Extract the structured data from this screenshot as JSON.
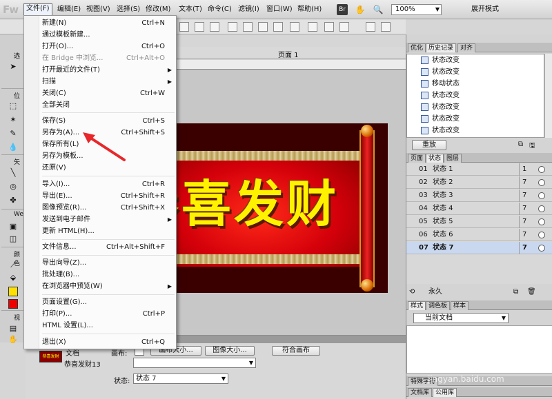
{
  "app": {
    "logo": "Fw",
    "zoom": "100%",
    "workspace_mode": "展开模式"
  },
  "menubar": {
    "items": [
      "文件(F)",
      "编辑(E)",
      "视图(V)",
      "选择(S)",
      "修改(M)",
      "文本(T)",
      "命令(C)",
      "滤镜(I)",
      "窗口(W)",
      "帮助(H)"
    ],
    "bridge_icon": "Br"
  },
  "document": {
    "page_label": "页面 1",
    "banner_text": "恭喜发财"
  },
  "tools_panel": {
    "labels": [
      "选",
      "位",
      "矢",
      "Web",
      "颜色",
      "视"
    ]
  },
  "file_menu": {
    "items": [
      {
        "label": "新建(N)",
        "shortcut": "Ctrl+N"
      },
      {
        "label": "通过模板新建...",
        "shortcut": ""
      },
      {
        "label": "打开(O)...",
        "shortcut": "Ctrl+O"
      },
      {
        "label": "在 Bridge 中浏览...",
        "shortcut": "Ctrl+Alt+O"
      },
      {
        "label": "打开最近的文件(T)",
        "shortcut": ""
      },
      {
        "label": "扫描",
        "shortcut": ""
      },
      {
        "label": "关闭(C)",
        "shortcut": "Ctrl+W"
      },
      {
        "label": "全部关闭",
        "shortcut": ""
      },
      {
        "label": "保存(S)",
        "shortcut": "Ctrl+S"
      },
      {
        "label": "另存为(A)...",
        "shortcut": "Ctrl+Shift+S"
      },
      {
        "label": "保存所有(L)",
        "shortcut": ""
      },
      {
        "label": "另存为模板...",
        "shortcut": ""
      },
      {
        "label": "还原(V)",
        "shortcut": ""
      },
      {
        "label": "导入(I)...",
        "shortcut": "Ctrl+R"
      },
      {
        "label": "导出(E)...",
        "shortcut": "Ctrl+Shift+R"
      },
      {
        "label": "图像预览(R)...",
        "shortcut": "Ctrl+Shift+X"
      },
      {
        "label": "发送到电子邮件",
        "shortcut": ""
      },
      {
        "label": "更新 HTML(H)...",
        "shortcut": ""
      },
      {
        "label": "文件信息...",
        "shortcut": "Ctrl+Alt+Shift+F"
      },
      {
        "label": "导出向导(Z)...",
        "shortcut": ""
      },
      {
        "label": "批处理(B)...",
        "shortcut": ""
      },
      {
        "label": "在浏览器中预览(W)",
        "shortcut": ""
      },
      {
        "label": "页面设置(G)...",
        "shortcut": ""
      },
      {
        "label": "打印(P)...",
        "shortcut": "Ctrl+P"
      },
      {
        "label": "HTML 设置(L)...",
        "shortcut": ""
      },
      {
        "label": "退出(X)",
        "shortcut": "Ctrl+Q"
      }
    ]
  },
  "properties": {
    "type_label": "文档",
    "doc_name": "恭喜发财13",
    "thumb_text": "恭喜发财",
    "canvas_label": "画布:",
    "canvas_size_button": "画布大小...",
    "image_size_button": "图像大小...",
    "fit_canvas_button": "符合画布",
    "state_label": "状态:",
    "state_value": "状态 7"
  },
  "right_panels": {
    "top_tabs": [
      "优化",
      "历史记录",
      "对齐"
    ],
    "history_items": [
      "状态改变",
      "状态改变",
      "移动状态",
      "状态改变",
      "状态改变",
      "状态改变",
      "状态改变"
    ],
    "replay_button": "重放",
    "mid_tabs": [
      "页面",
      "状态",
      "图层"
    ],
    "states": [
      {
        "num": "01",
        "name": "状态 1",
        "delay": "1"
      },
      {
        "num": "02",
        "name": "状态 2",
        "delay": "7"
      },
      {
        "num": "03",
        "name": "状态 3",
        "delay": "7"
      },
      {
        "num": "04",
        "name": "状态 4",
        "delay": "7"
      },
      {
        "num": "05",
        "name": "状态 5",
        "delay": "7"
      },
      {
        "num": "06",
        "name": "状态 6",
        "delay": "7"
      },
      {
        "num": "07",
        "name": "状态 7",
        "delay": "7"
      }
    ],
    "loop_label": "永久",
    "bottom_tabs": [
      "样式",
      "调色板",
      "样本"
    ],
    "styles_select": "当前文档",
    "library_tabs": [
      "特殊字符",
      "文档库",
      "公用库"
    ]
  },
  "watermark": {
    "brand": "Baidu 经验",
    "url": "jingyan.baidu.com"
  }
}
